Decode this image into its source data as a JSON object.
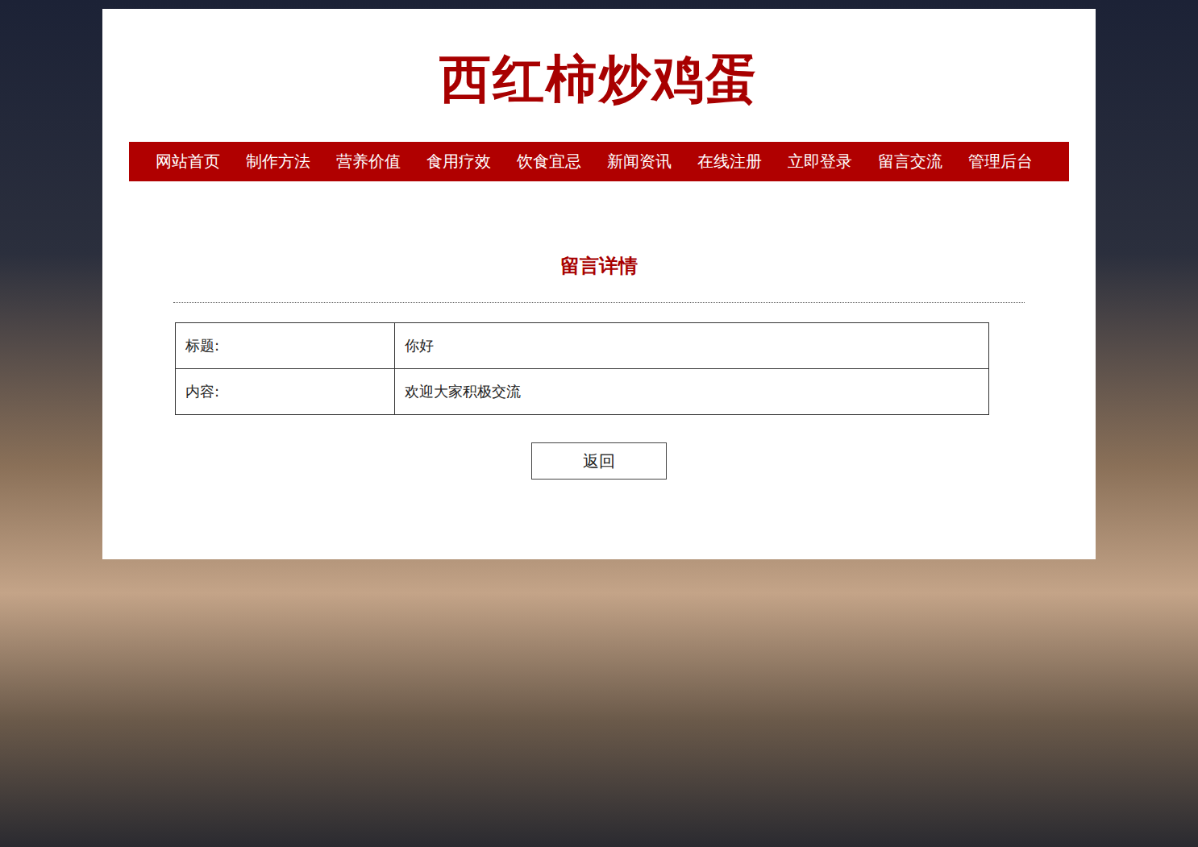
{
  "site_title": "西红柿炒鸡蛋",
  "nav": [
    {
      "label": "网站首页"
    },
    {
      "label": "制作方法"
    },
    {
      "label": "营养价值"
    },
    {
      "label": "食用疗效"
    },
    {
      "label": "饮食宜忌"
    },
    {
      "label": "新闻资讯"
    },
    {
      "label": "在线注册"
    },
    {
      "label": "立即登录"
    },
    {
      "label": "留言交流"
    },
    {
      "label": "管理后台"
    }
  ],
  "page_heading": "留言详情",
  "details": [
    {
      "label": "标题:",
      "value": "你好"
    },
    {
      "label": "内容:",
      "value": "欢迎大家积极交流"
    }
  ],
  "buttons": [
    "返回"
  ]
}
